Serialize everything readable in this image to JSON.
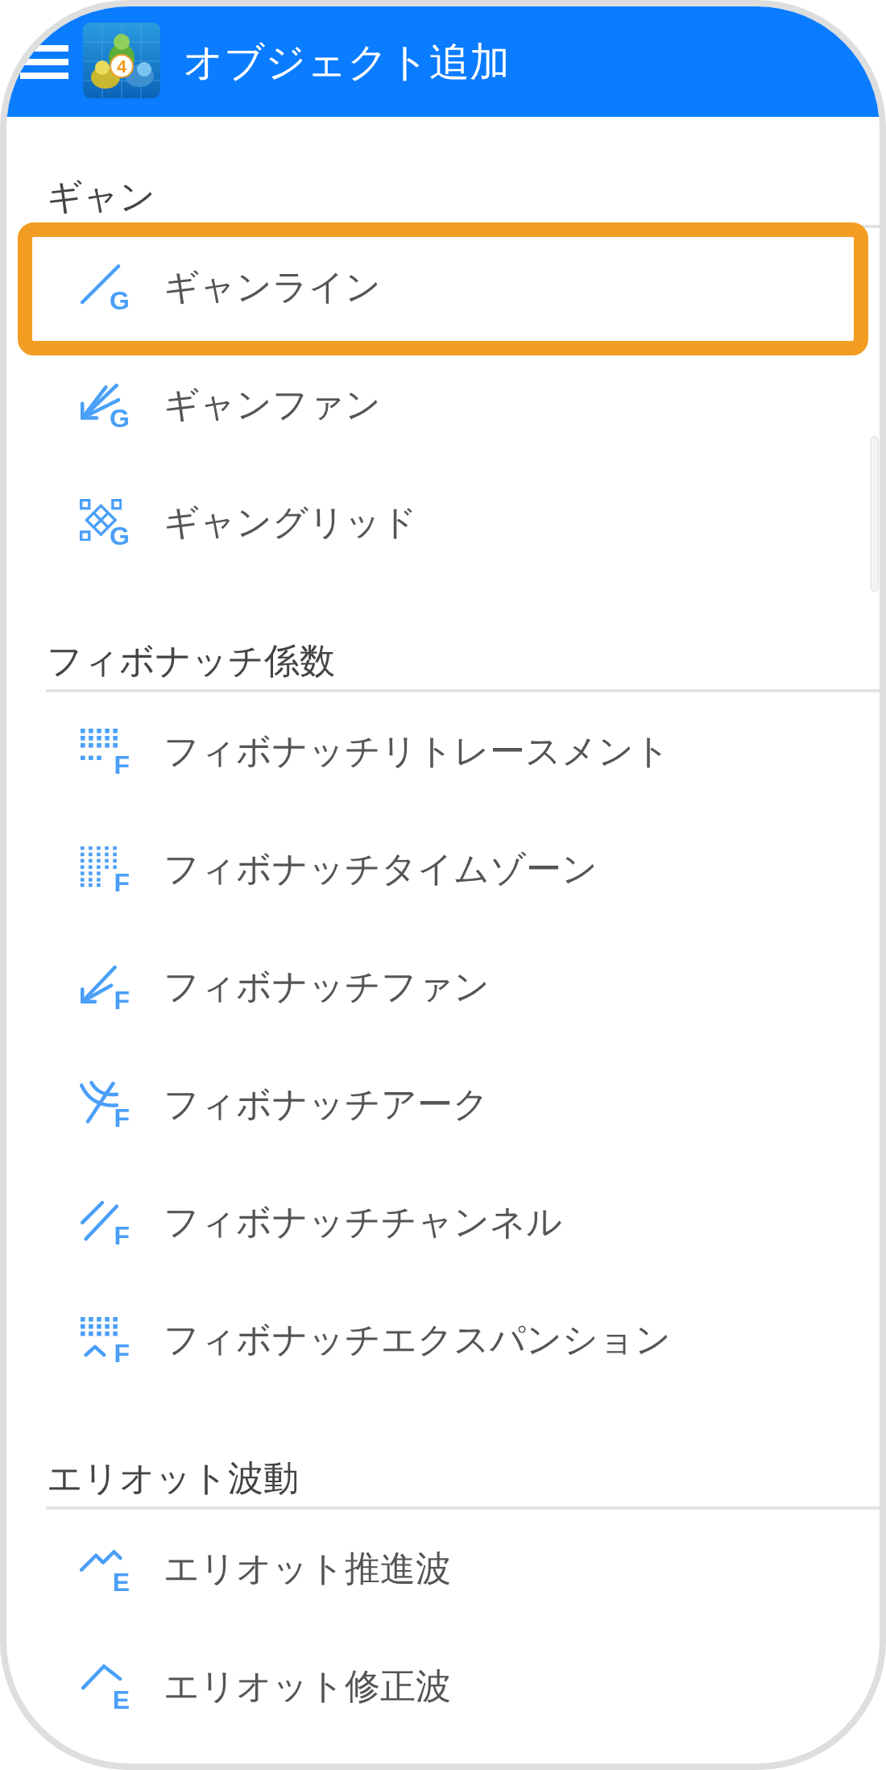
{
  "header": {
    "title": "オブジェクト追加",
    "logo_badge": "4"
  },
  "sections": [
    {
      "title": "ギャン",
      "items": [
        {
          "label": "ギャンライン",
          "kind": "line",
          "icon_letter": "G",
          "highlighted": true
        },
        {
          "label": "ギャンファン",
          "kind": "fan",
          "icon_letter": "G",
          "highlighted": false
        },
        {
          "label": "ギャングリッド",
          "kind": "grid",
          "icon_letter": "G",
          "highlighted": false
        }
      ]
    },
    {
      "title": "フィボナッチ係数",
      "items": [
        {
          "label": "フィボナッチリトレースメント",
          "kind": "retracement",
          "icon_letter": "F",
          "highlighted": false
        },
        {
          "label": "フィボナッチタイムゾーン",
          "kind": "timezones",
          "icon_letter": "F",
          "highlighted": false
        },
        {
          "label": "フィボナッチファン",
          "kind": "arrow",
          "icon_letter": "F",
          "highlighted": false
        },
        {
          "label": "フィボナッチアーク",
          "kind": "arcs",
          "icon_letter": "F",
          "highlighted": false
        },
        {
          "label": "フィボナッチチャンネル",
          "kind": "channel",
          "icon_letter": "F",
          "highlighted": false
        },
        {
          "label": "フィボナッチエクスパンション",
          "kind": "expansion",
          "icon_letter": "F",
          "highlighted": false
        }
      ]
    },
    {
      "title": "エリオット波動",
      "items": [
        {
          "label": "エリオット推進波",
          "kind": "impulse",
          "icon_letter": "E",
          "highlighted": false
        },
        {
          "label": "エリオット修正波",
          "kind": "correction",
          "icon_letter": "E",
          "highlighted": false
        }
      ]
    }
  ]
}
